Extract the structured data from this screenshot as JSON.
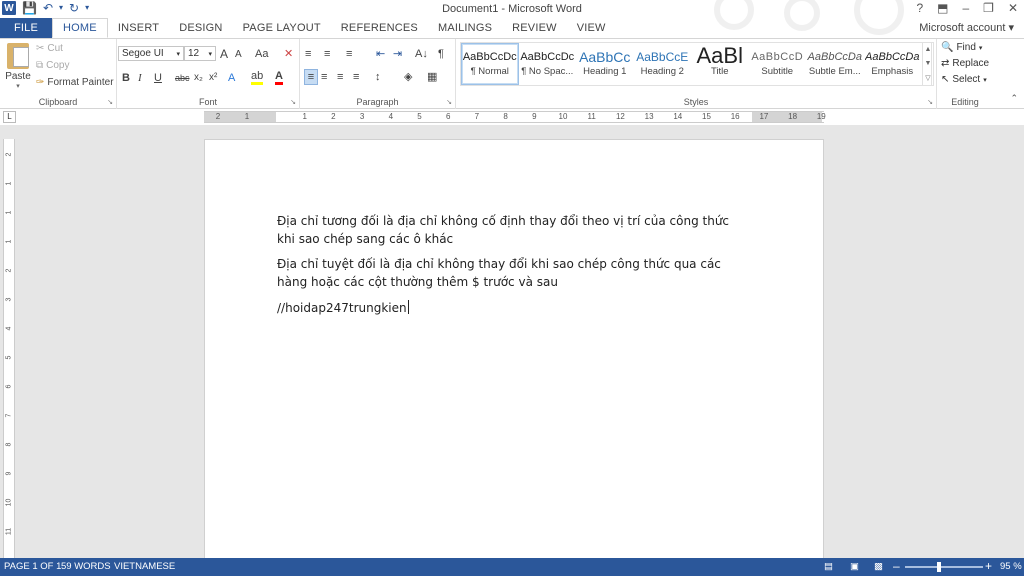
{
  "titlebar": {
    "title": "Document1 - Microsoft Word",
    "logo": "W",
    "help": "?",
    "restore_ribbon": "⬒",
    "minimize": "–",
    "maximize": "❐",
    "close": "✕"
  },
  "tabs": {
    "file": "FILE",
    "home": "HOME",
    "insert": "INSERT",
    "design": "DESIGN",
    "page_layout": "PAGE LAYOUT",
    "references": "REFERENCES",
    "mailings": "MAILINGS",
    "review": "REVIEW",
    "view": "VIEW",
    "account": "Microsoft account ▾"
  },
  "clipboard": {
    "paste": "Paste",
    "cut": "Cut",
    "copy": "Copy",
    "format_painter": "Format Painter",
    "label": "Clipboard"
  },
  "font": {
    "family": "Segoe UI",
    "size": "12",
    "grow": "A",
    "shrink": "A",
    "case": "Aa",
    "bold": "B",
    "italic": "I",
    "underline": "U",
    "strike": "abc",
    "subscript": "x₂",
    "superscript": "x²",
    "label": "Font"
  },
  "paragraph": {
    "label": "Paragraph",
    "pilcrow": "¶",
    "sort": "A↓"
  },
  "styles": {
    "label": "Styles",
    "items": [
      {
        "sample": "AaBbCcDc",
        "name": "¶ Normal"
      },
      {
        "sample": "AaBbCcDc",
        "name": "¶ No Spac..."
      },
      {
        "sample": "AaBbCc",
        "name": "Heading 1"
      },
      {
        "sample": "AaBbCcE",
        "name": "Heading 2"
      },
      {
        "sample": "AaBl",
        "name": "Title"
      },
      {
        "sample": "AaBbCcD",
        "name": "Subtitle"
      },
      {
        "sample": "AaBbCcDa",
        "name": "Subtle Em..."
      },
      {
        "sample": "AaBbCcDa",
        "name": "Emphasis"
      }
    ]
  },
  "editing": {
    "find": "Find",
    "replace": "Replace",
    "select": "Select",
    "label": "Editing"
  },
  "ruler": {
    "corner": "L",
    "h_numbers": [
      "2",
      "1",
      "1",
      "2",
      "3",
      "4",
      "5",
      "6",
      "7",
      "8",
      "9",
      "10",
      "11",
      "12",
      "13",
      "14",
      "15",
      "16",
      "17",
      "18",
      "19"
    ],
    "v_numbers": [
      "2",
      "1",
      "1",
      "1",
      "2",
      "3",
      "4",
      "5",
      "6",
      "7",
      "8",
      "9",
      "10",
      "11"
    ]
  },
  "document": {
    "paragraphs": [
      "Địa chỉ tương đối là địa chỉ không cố định thay đổi theo vị trí của công thức khi sao chép sang các ô khác",
      "Địa chỉ tuyệt đối là địa chỉ không thay đổi khi sao chép công thức qua các hàng hoặc các cột thường thêm $ trước và sau",
      "//hoidap247trungkien"
    ]
  },
  "status": {
    "page": "PAGE 1 OF 1",
    "words": "59 WORDS",
    "language": "VIETNAMESE",
    "zoom_minus": "–",
    "zoom_plus": "+",
    "zoom": "95 %",
    "zoom_level": 0.95
  },
  "colors": {
    "accent": "#2b579a",
    "highlight": "#ffff00",
    "font_color": "#ff0000"
  }
}
